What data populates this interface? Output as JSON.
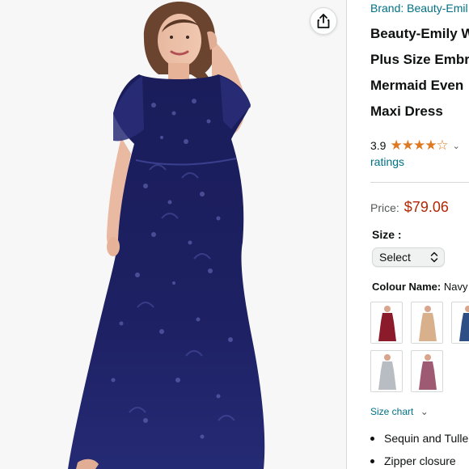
{
  "product": {
    "brand_text": "Brand: Beauty-Emil",
    "title_lines": [
      "Beauty-Emily W",
      "Plus Size Embr",
      "Mermaid Even",
      "Maxi Dress"
    ]
  },
  "rating": {
    "value": "3.9",
    "stars": "★★★★☆",
    "ratings_link": "ratings",
    "chevron": "⌄"
  },
  "price": {
    "label": "Price:",
    "value": "$79.06",
    "color": "#b12704"
  },
  "size": {
    "label": "Size :",
    "selected": "Select"
  },
  "colour": {
    "label": "Colour Name:",
    "value": "Navy",
    "swatches": [
      {
        "name": "burgundy",
        "color": "#8b1a2b"
      },
      {
        "name": "champagne",
        "color": "#d8b08c"
      },
      {
        "name": "navy",
        "color": "#2e4f86"
      },
      {
        "name": "grey",
        "color": "#b8bcc3"
      },
      {
        "name": "mauve",
        "color": "#9e5a73"
      }
    ]
  },
  "size_chart": {
    "label": "Size chart",
    "chevron": "⌄"
  },
  "bullets": [
    "Sequin and Tulle",
    "Zipper closure"
  ],
  "colors": {
    "link": "#007185",
    "stars": "#de7921",
    "dress": "#1c1f5c"
  },
  "icons": {
    "share": "share-icon",
    "select_arrows": "up-down-chevron-icon"
  }
}
